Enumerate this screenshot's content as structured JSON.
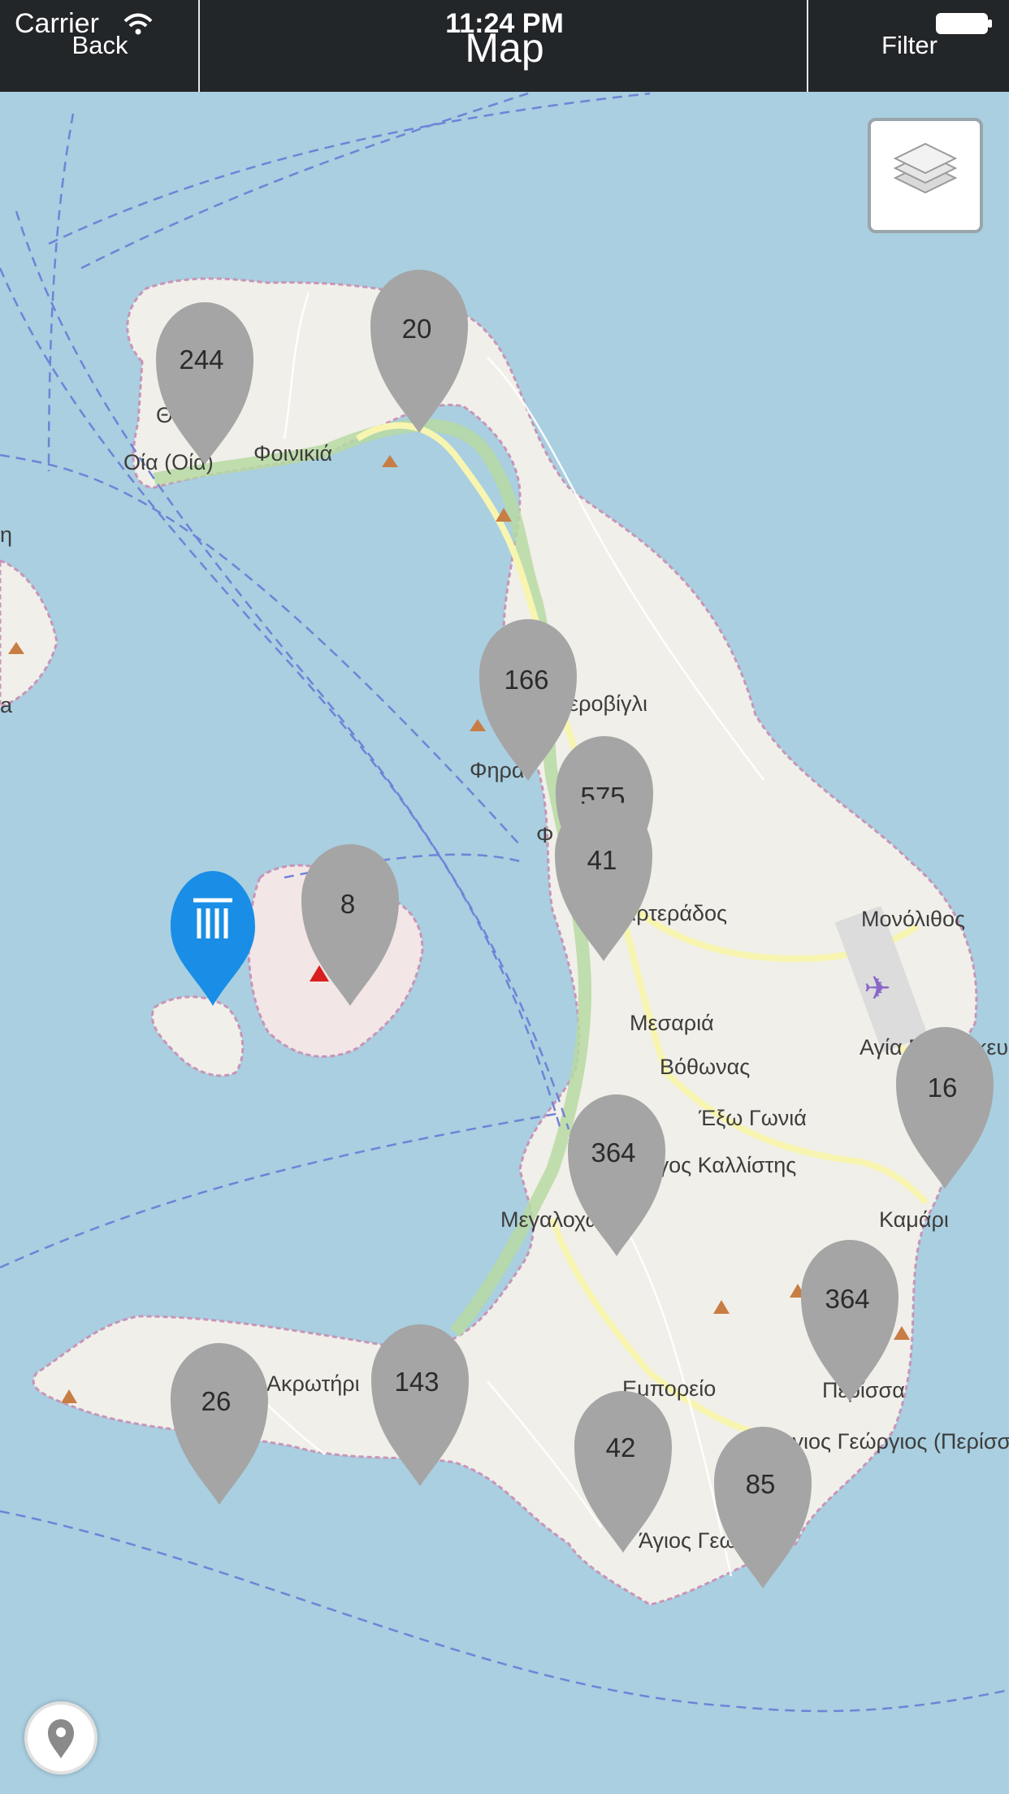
{
  "status_bar": {
    "carrier": "Carrier",
    "time": "11:24 PM"
  },
  "nav": {
    "back_label": "Back",
    "title": "Map",
    "filter_label": "Filter"
  },
  "map": {
    "place_labels": [
      "Θ",
      "Οία (Οία)",
      "Φοινικιά",
      "η",
      "a",
      "Ημεροβίγλι",
      "Φηρά",
      "Φ",
      "Καρτεράδος",
      "Μονόλιθος",
      "Μεσαριά",
      "Βόθωνας",
      "Αγία Παρασκευή",
      "Έξω Γωνιά",
      "Πύργος Καλλίστης",
      "Καμάρι",
      "Μεγαλοχώρι",
      "Ακρωτήρι",
      "Εμπορείο",
      "Περίσσα",
      "Άγιος Γεώργιος (Περίσσα)",
      "Άγιος Γεώργιος"
    ],
    "clusters": [
      "244",
      "20",
      "166",
      "575",
      "41",
      "8",
      "16",
      "364",
      "364",
      "26",
      "143",
      "42",
      "85"
    ],
    "colors": {
      "sea": "#a9cfe0",
      "land": "#f1efe9",
      "cluster": "#a5a5a5",
      "poi": "#1a8ee6",
      "route": "#6f83d8",
      "road": "#f7f5b0"
    }
  },
  "icons": {
    "layers": "layers-icon",
    "locate": "location-pin-icon",
    "poi": "archaeological-site-icon",
    "airport": "airport-icon"
  }
}
